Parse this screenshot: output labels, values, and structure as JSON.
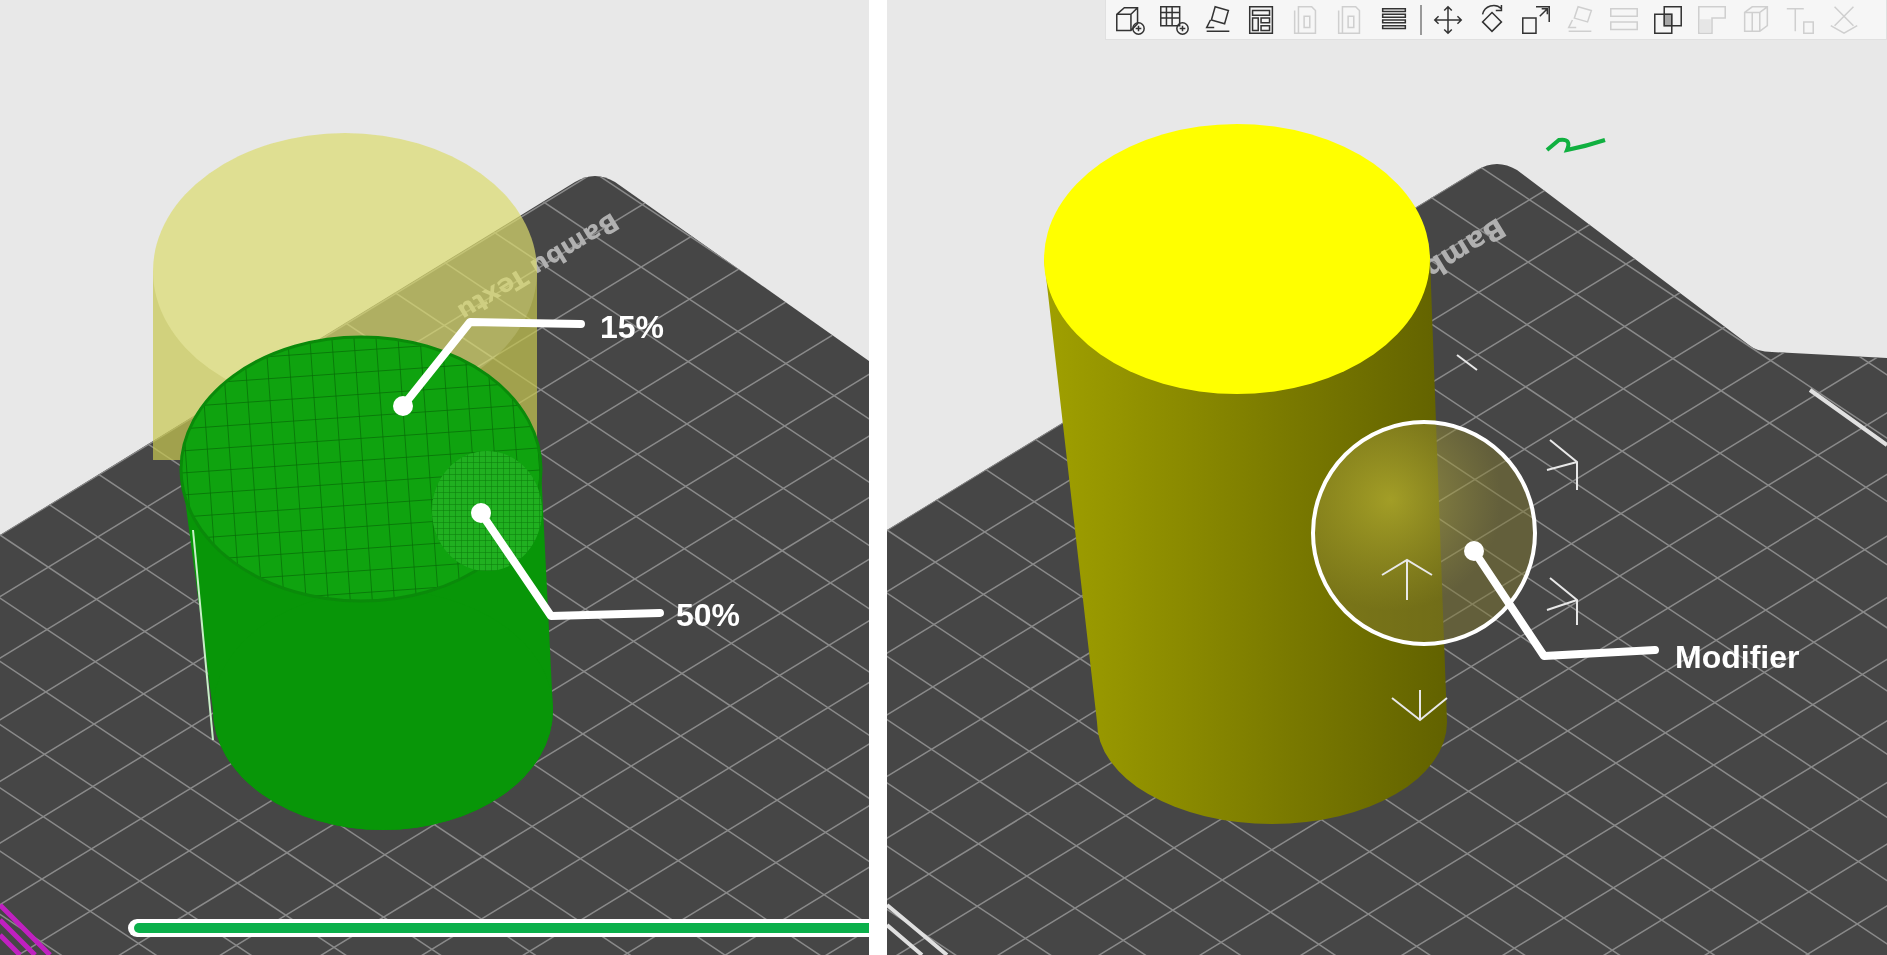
{
  "left_panel": {
    "bed_label": "Bambu Textu",
    "callouts": [
      {
        "label": "15%"
      },
      {
        "label": "50%"
      }
    ],
    "progress_bar": {
      "level": 1
    }
  },
  "right_panel": {
    "bed_label": "Bamb",
    "toolbar": [
      {
        "kind": "add-cube",
        "disabled": false
      },
      {
        "kind": "add-plate",
        "disabled": false
      },
      {
        "kind": "auto-orient",
        "disabled": false
      },
      {
        "kind": "arrange",
        "disabled": false
      },
      {
        "kind": "page",
        "disabled": true
      },
      {
        "kind": "page",
        "disabled": true
      },
      {
        "kind": "layers",
        "disabled": false
      },
      {
        "kind": "separator",
        "disabled": false
      },
      {
        "kind": "move",
        "disabled": false
      },
      {
        "kind": "rotate",
        "disabled": false
      },
      {
        "kind": "scale",
        "disabled": false
      },
      {
        "kind": "lay-flat",
        "disabled": true
      },
      {
        "kind": "split",
        "disabled": true
      },
      {
        "kind": "boolean",
        "disabled": false
      },
      {
        "kind": "paint",
        "disabled": true
      },
      {
        "kind": "seam",
        "disabled": true
      },
      {
        "kind": "text-tool",
        "disabled": true
      },
      {
        "kind": "cut",
        "disabled": true
      }
    ],
    "callouts": [
      {
        "label": "Modifier"
      }
    ]
  }
}
